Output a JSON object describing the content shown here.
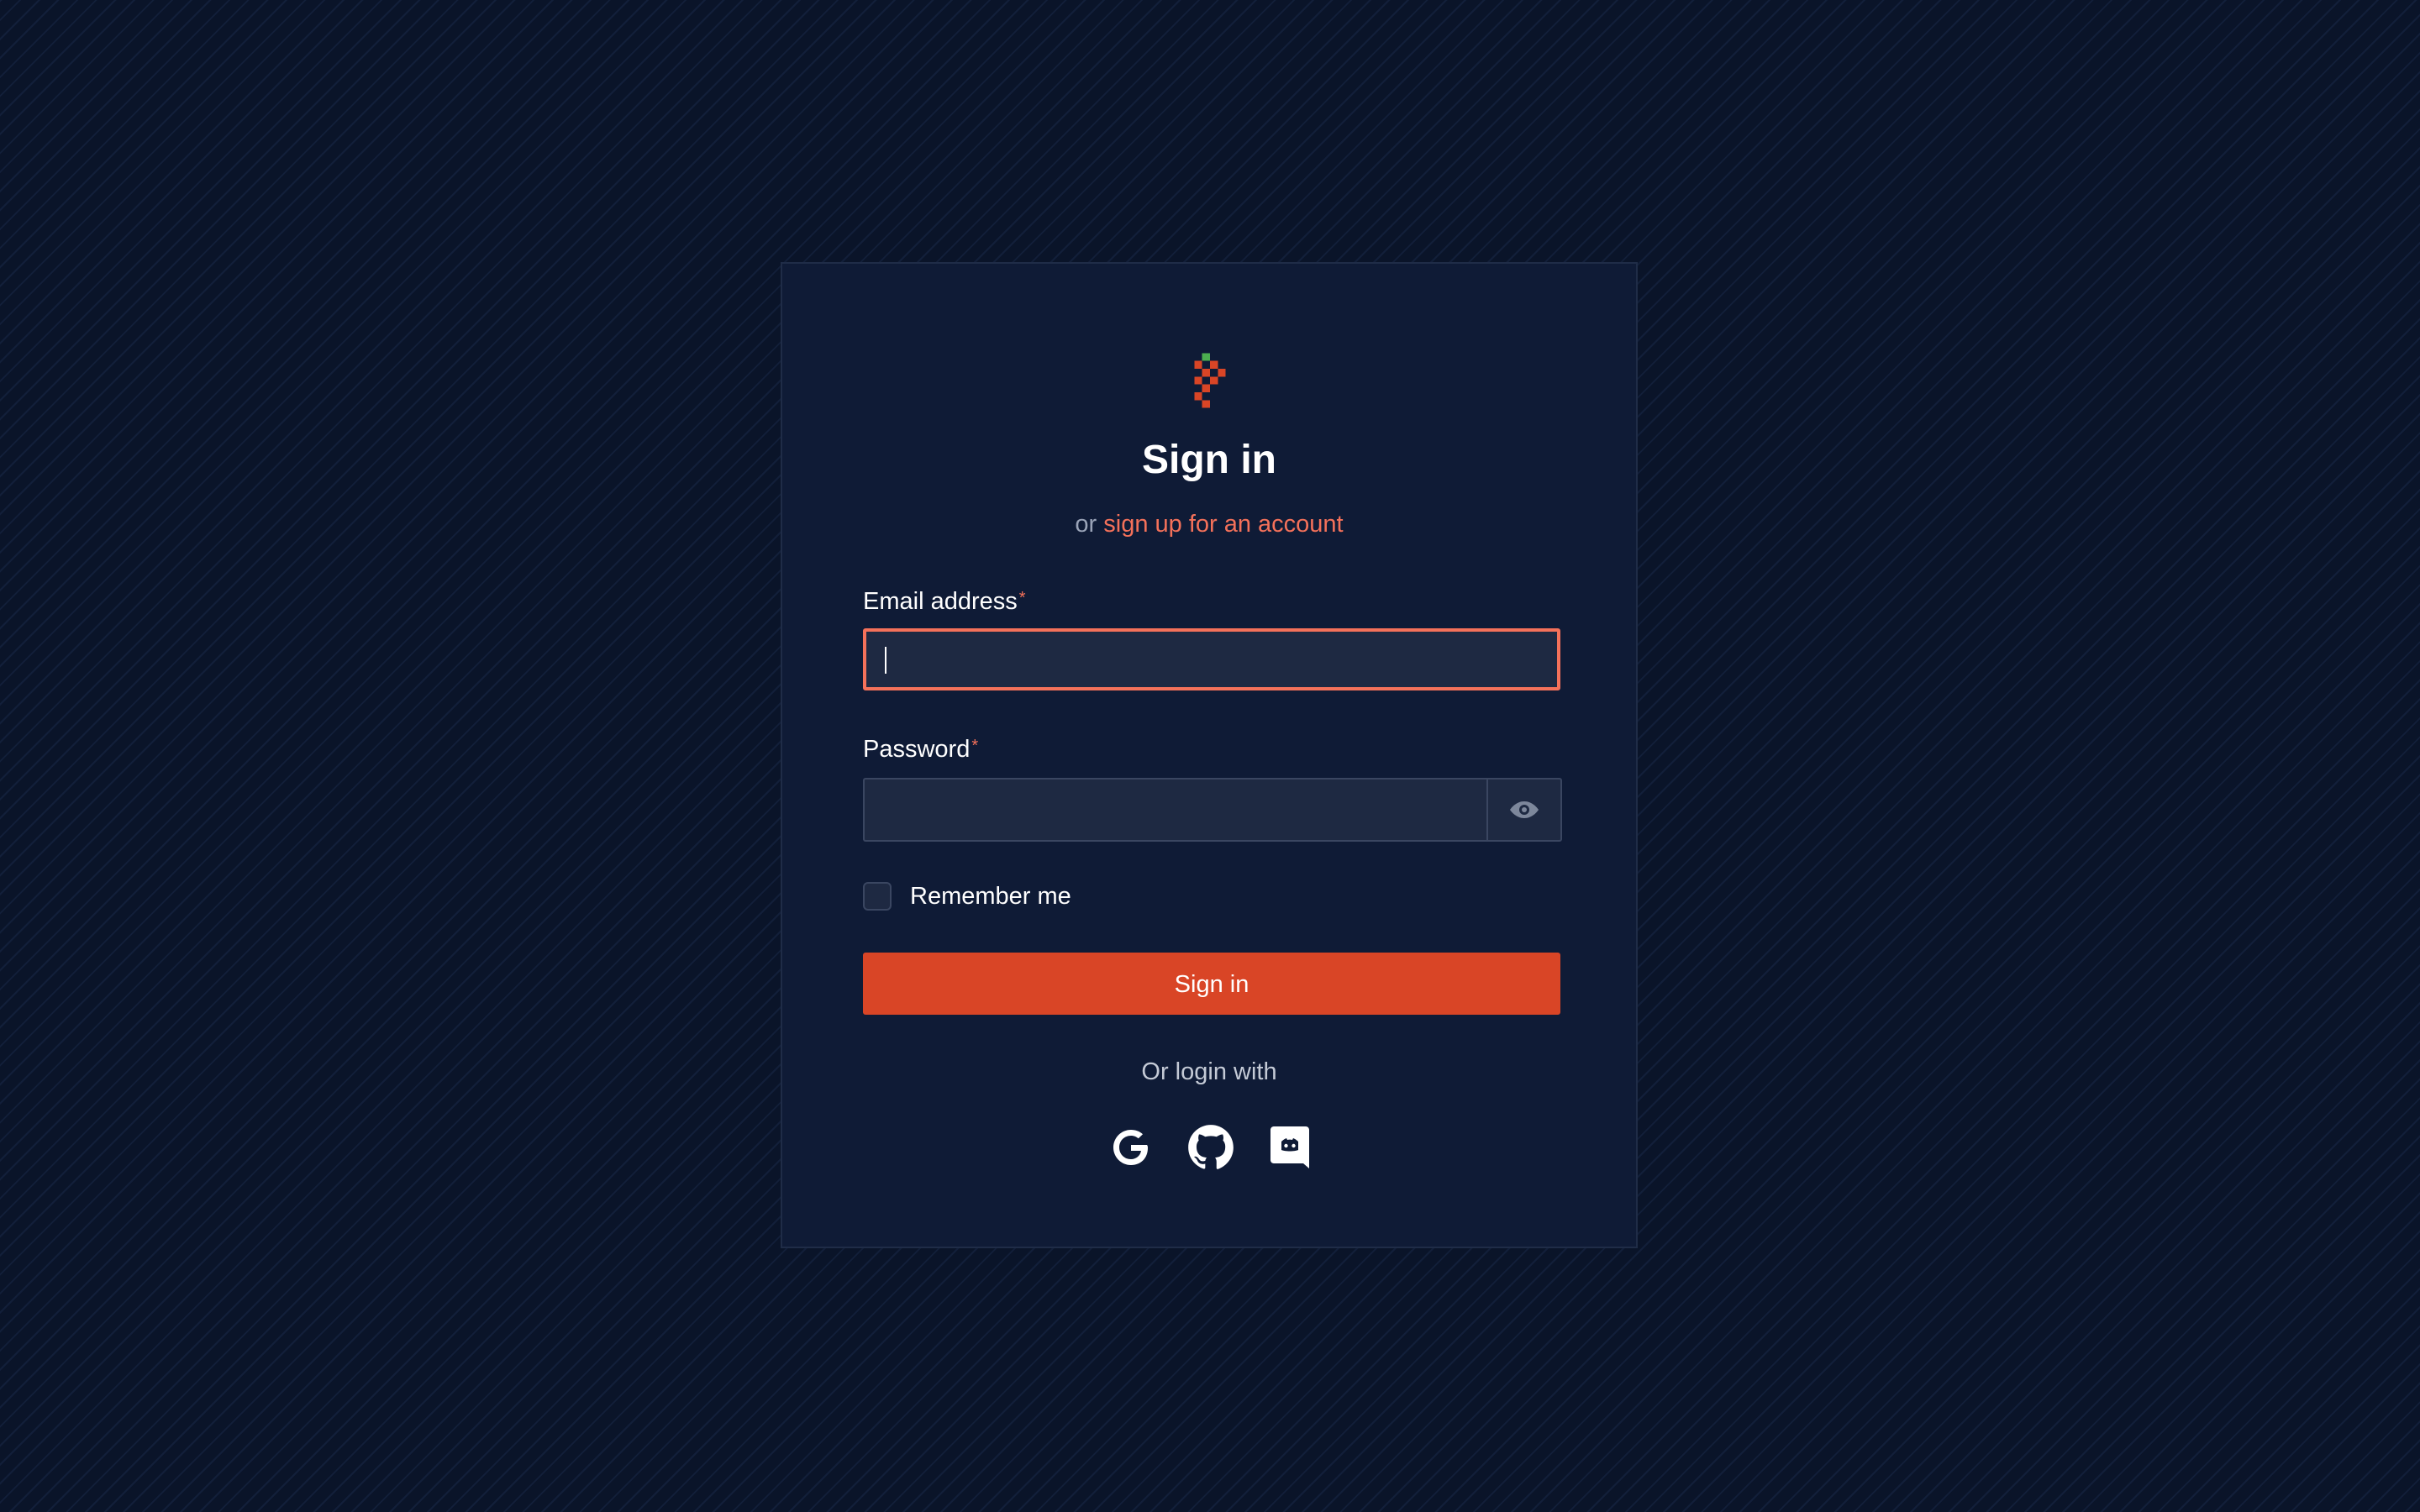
{
  "brand": {
    "logo_icon": "pixel-berry-logo",
    "accent_color": "#d94526",
    "link_color": "#f4715a",
    "leaf_color": "#4caf50",
    "background_color": "#0a1429",
    "card_color": "#0f1b36"
  },
  "header": {
    "title": "Sign in",
    "subtitle_prefix": "or",
    "signup_link": "sign up for an account"
  },
  "form": {
    "email": {
      "label": "Email address",
      "required_mark": "*",
      "value": "",
      "focused": true
    },
    "password": {
      "label": "Password",
      "required_mark": "*",
      "value": "",
      "toggle_icon": "eye-icon"
    },
    "remember": {
      "label": "Remember me",
      "checked": false
    },
    "submit_label": "Sign in"
  },
  "social": {
    "heading": "Or login with",
    "providers": [
      {
        "name": "Google",
        "icon": "google-icon"
      },
      {
        "name": "GitHub",
        "icon": "github-icon"
      },
      {
        "name": "Discord",
        "icon": "discord-icon"
      }
    ]
  }
}
